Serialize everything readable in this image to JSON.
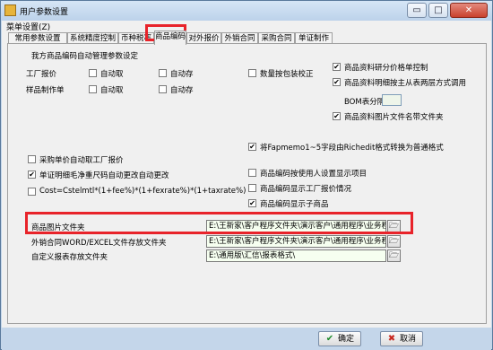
{
  "window": {
    "title": "用户参数设置",
    "menu": [
      "菜单设置(Z)"
    ]
  },
  "window_controls": {
    "minimize": "▭",
    "maximize": "□",
    "close": "✕"
  },
  "tabs": [
    {
      "label": "常用参数设置"
    },
    {
      "label": "系统精度控制"
    },
    {
      "label": "币种税率"
    },
    {
      "label": "商品编码",
      "active": true
    },
    {
      "label": "对外报价"
    },
    {
      "label": "外销合同"
    },
    {
      "label": "采购合同"
    },
    {
      "label": "单证制作"
    }
  ],
  "panel": {
    "section_title": "我方商品编码自动管理参数设定",
    "row_quote": {
      "label": "工厂报价",
      "auto_fetch": "自动取",
      "auto_save": "自动存",
      "qty_check": "数量按包装校正"
    },
    "row_sample": {
      "label": "样品制作单",
      "auto_fetch": "自动取",
      "auto_save": "自动存"
    },
    "right_options": {
      "opt1": "商品资料研分价格单控制",
      "opt2": "商品资料明细按主从表两层方式调用",
      "bom_label": "BOM表分隔符",
      "bom_value": "",
      "opt3": "商品资料图片文件名带文件夹"
    },
    "rtf_option": "将Fapmemo1~5字段由Richedit格式转换为普通格式",
    "purchase_option": "采购单价自动取工厂报价",
    "doc_option": "单证明细毛净重尺码自动更改自动更改",
    "cost_option": "Cost=Cstelmtl*(1+fee%)*(1+fexrate%)*(1+taxrate%)",
    "right_lower": {
      "opt1": "商品编码按使用人设置显示项目",
      "opt2": "商品编码显示工厂报价情况",
      "opt3": "商品编码显示子商品"
    },
    "folders": [
      {
        "label": "商品图片文件夹",
        "path": "E:\\王新家\\客户程序文件夹\\演示客户\\通用程序\\业务程"
      },
      {
        "label": "外销合同WORD/EXCEL文件存放文件夹",
        "path": "E:\\王新家\\客户程序文件夹\\演示客户\\通用程序\\业务程"
      },
      {
        "label": "自定义报表存放文件夹",
        "path": "E:\\通用版\\汇信\\报表格式\\"
      }
    ]
  },
  "footer": {
    "ok_label": "确定",
    "ok_icon": "✔",
    "cancel_label": "取消",
    "cancel_icon": "✖"
  },
  "colors": {
    "highlight": "#e8232a",
    "path_bg": "#f6fff0",
    "window_frame": "#c4d6ea"
  },
  "icons": {
    "folder_browse": "folder-open-icon",
    "title": "app-icon"
  }
}
